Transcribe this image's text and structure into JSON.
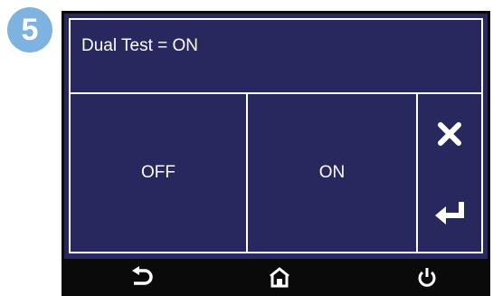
{
  "step": {
    "number": "5",
    "badge_color": "#7eb3e0"
  },
  "screen": {
    "title": "Dual Test = ON",
    "background_color": "#28285f",
    "options": [
      {
        "label": "OFF"
      },
      {
        "label": "ON"
      }
    ],
    "side_buttons": {
      "cancel_icon": "close-icon",
      "enter_icon": "enter-arrow-icon"
    }
  },
  "bottom_bar": {
    "icons": [
      "back-arrow-icon",
      "home-icon",
      "power-icon"
    ]
  }
}
